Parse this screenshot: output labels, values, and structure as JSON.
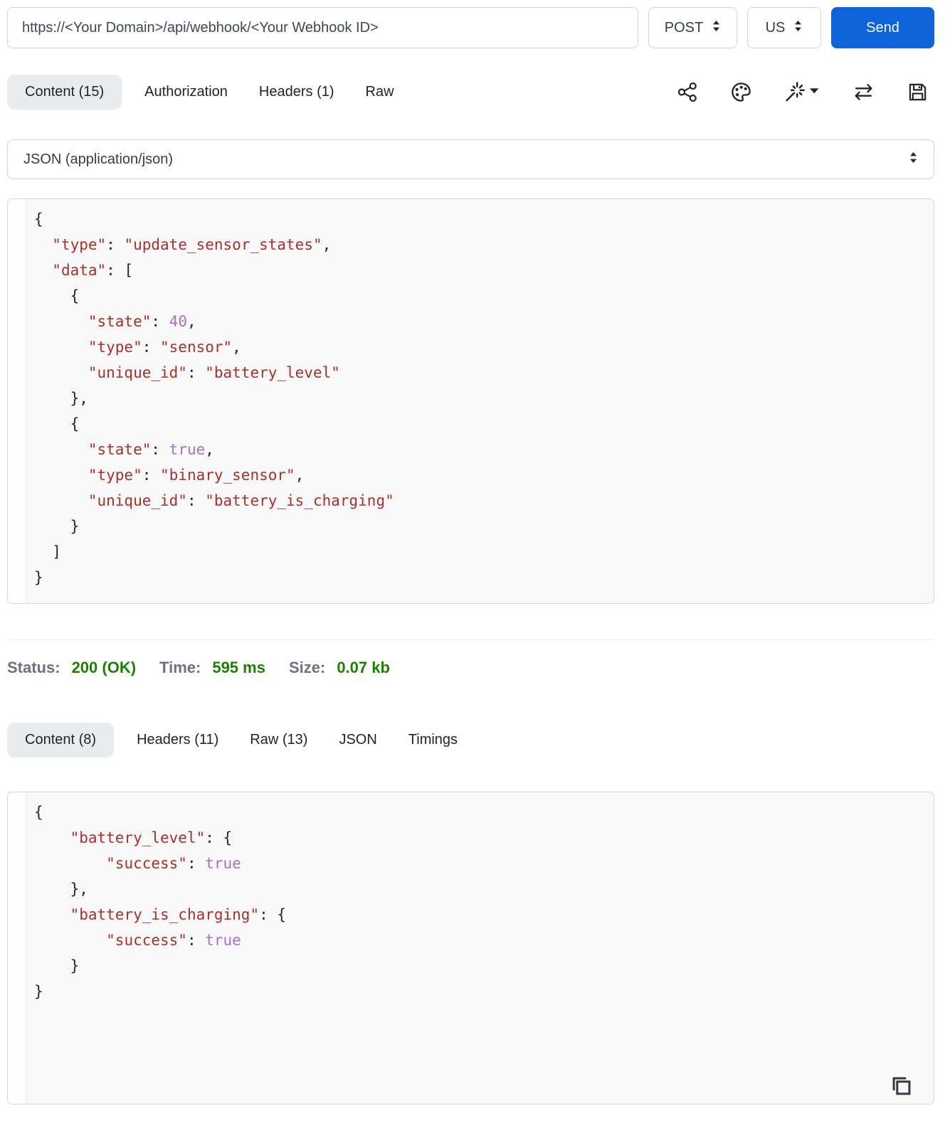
{
  "request_bar": {
    "url": "https://<Your Domain>/api/webhook/<Your Webhook ID>",
    "method": "POST",
    "locale": "US",
    "send_label": "Send"
  },
  "request_tabs": {
    "items": [
      {
        "label": "Content (15)",
        "active": true
      },
      {
        "label": "Authorization",
        "active": false
      },
      {
        "label": "Headers (1)",
        "active": false
      },
      {
        "label": "Raw",
        "active": false
      }
    ]
  },
  "toolbar": {
    "icons": [
      "share-icon",
      "palette-icon",
      "magic-wand-dropdown-icon",
      "swap-arrows-icon",
      "save-icon"
    ]
  },
  "body_type_select": {
    "value": "JSON (application/json)"
  },
  "request_body": {
    "lines": [
      [
        [
          "p",
          "{"
        ]
      ],
      [
        [
          "p",
          "  "
        ],
        [
          "s",
          "\"type\""
        ],
        [
          "p",
          ": "
        ],
        [
          "s",
          "\"update_sensor_states\""
        ],
        [
          "p",
          ","
        ]
      ],
      [
        [
          "p",
          "  "
        ],
        [
          "s",
          "\"data\""
        ],
        [
          "p",
          ": ["
        ]
      ],
      [
        [
          "p",
          "    {"
        ]
      ],
      [
        [
          "p",
          "      "
        ],
        [
          "s",
          "\"state\""
        ],
        [
          "p",
          ": "
        ],
        [
          "v",
          "40"
        ],
        [
          "p",
          ","
        ]
      ],
      [
        [
          "p",
          "      "
        ],
        [
          "s",
          "\"type\""
        ],
        [
          "p",
          ": "
        ],
        [
          "s",
          "\"sensor\""
        ],
        [
          "p",
          ","
        ]
      ],
      [
        [
          "p",
          "      "
        ],
        [
          "s",
          "\"unique_id\""
        ],
        [
          "p",
          ": "
        ],
        [
          "s",
          "\"battery_level\""
        ]
      ],
      [
        [
          "p",
          "    },"
        ]
      ],
      [
        [
          "p",
          "    {"
        ]
      ],
      [
        [
          "p",
          "      "
        ],
        [
          "s",
          "\"state\""
        ],
        [
          "p",
          ": "
        ],
        [
          "v",
          "true"
        ],
        [
          "p",
          ","
        ]
      ],
      [
        [
          "p",
          "      "
        ],
        [
          "s",
          "\"type\""
        ],
        [
          "p",
          ": "
        ],
        [
          "s",
          "\"binary_sensor\""
        ],
        [
          "p",
          ","
        ]
      ],
      [
        [
          "p",
          "      "
        ],
        [
          "s",
          "\"unique_id\""
        ],
        [
          "p",
          ": "
        ],
        [
          "s",
          "\"battery_is_charging\""
        ]
      ],
      [
        [
          "p",
          "    }"
        ]
      ],
      [
        [
          "p",
          "  ]"
        ]
      ],
      [
        [
          "p",
          "}"
        ]
      ]
    ]
  },
  "response_summary": {
    "status_label": "Status:",
    "status_value": "200 (OK)",
    "time_label": "Time:",
    "time_value": "595 ms",
    "size_label": "Size:",
    "size_value": "0.07 kb"
  },
  "response_tabs": {
    "items": [
      {
        "label": "Content (8)",
        "active": true
      },
      {
        "label": "Headers (11)",
        "active": false
      },
      {
        "label": "Raw (13)",
        "active": false
      },
      {
        "label": "JSON",
        "active": false
      },
      {
        "label": "Timings",
        "active": false
      }
    ]
  },
  "response_body": {
    "lines": [
      [
        [
          "p",
          "{"
        ]
      ],
      [
        [
          "p",
          "    "
        ],
        [
          "s",
          "\"battery_level\""
        ],
        [
          "p",
          ": {"
        ]
      ],
      [
        [
          "p",
          "        "
        ],
        [
          "s",
          "\"success\""
        ],
        [
          "p",
          ": "
        ],
        [
          "v",
          "true"
        ]
      ],
      [
        [
          "p",
          "    },"
        ]
      ],
      [
        [
          "p",
          "    "
        ],
        [
          "s",
          "\"battery_is_charging\""
        ],
        [
          "p",
          ": {"
        ]
      ],
      [
        [
          "p",
          "        "
        ],
        [
          "s",
          "\"success\""
        ],
        [
          "p",
          ": "
        ],
        [
          "v",
          "true"
        ]
      ],
      [
        [
          "p",
          "    }"
        ]
      ],
      [
        [
          "p",
          "}"
        ]
      ]
    ]
  },
  "colors": {
    "send_button": "#0d64da",
    "success_green": "#1e8000",
    "status_label_gray": "#6b7280",
    "code_string_red": "#a5312d",
    "code_value_purple": "#a671c6",
    "code_punct": "#22272e",
    "active_tab_bg": "#e9ecef",
    "code_bg": "#f8f8f8"
  }
}
